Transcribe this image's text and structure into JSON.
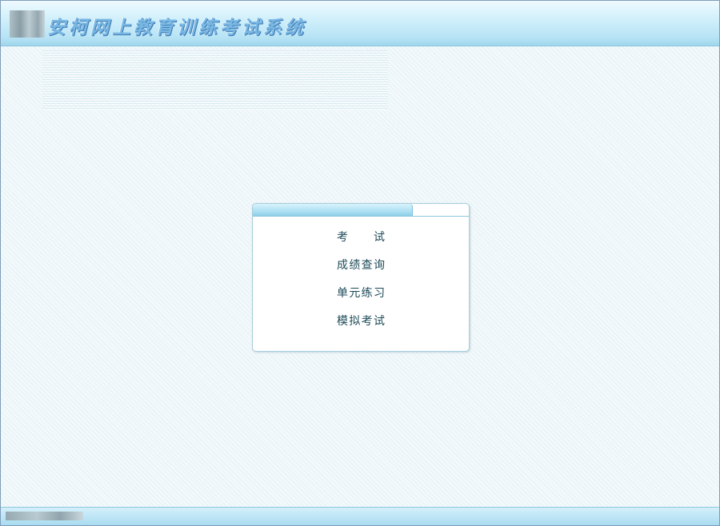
{
  "header": {
    "title": "安柯网上教育训练考试系统"
  },
  "menu": {
    "items": [
      {
        "label": "考 试"
      },
      {
        "label": "成绩查询"
      },
      {
        "label": "单元练习"
      },
      {
        "label": "模拟考试"
      }
    ]
  },
  "colors": {
    "header_gradient_top": "#eefaff",
    "header_gradient_bottom": "#9fd5ec",
    "title_color": "#7ab8e4",
    "menu_text": "#1d4a58",
    "page_background": "#f3f9fb",
    "tab_accent": "#8dcfe9"
  },
  "icons": {
    "header_logo": "logo-icon",
    "footer_logo": "logo-icon"
  }
}
